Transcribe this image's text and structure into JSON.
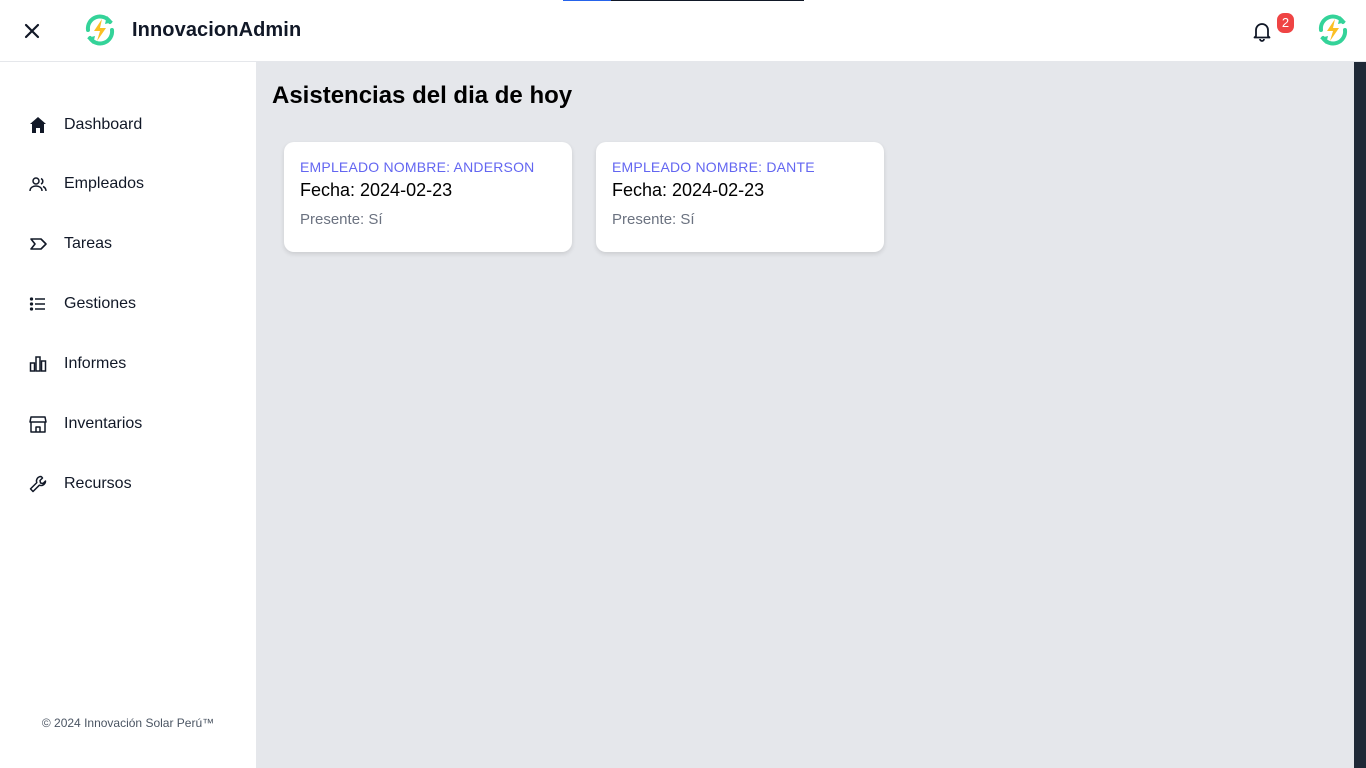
{
  "header": {
    "close_icon": "close-icon",
    "brand": "InnovacionAdmin",
    "notifications_count": "2",
    "colors": {
      "logo_green": "#34d399",
      "logo_bolt": "#fbbf24",
      "badge": "#ef4444"
    }
  },
  "sidebar": {
    "items": [
      {
        "label": "Dashboard",
        "icon": "home-icon"
      },
      {
        "label": "Empleados",
        "icon": "users-icon"
      },
      {
        "label": "Tareas",
        "icon": "tag-icon"
      },
      {
        "label": "Gestiones",
        "icon": "list-icon"
      },
      {
        "label": "Informes",
        "icon": "bar-chart-icon"
      },
      {
        "label": "Inventarios",
        "icon": "store-icon"
      },
      {
        "label": "Recursos",
        "icon": "wrench-icon"
      }
    ],
    "footer": "© 2024 Innovación Solar Perú™"
  },
  "main": {
    "title": "Asistencias del dia de hoy",
    "cards": [
      {
        "name": "Empleado Nombre: Anderson",
        "date": "Fecha: 2024-02-23",
        "present": "Presente: Sí"
      },
      {
        "name": "Empleado Nombre: Dante",
        "date": "Fecha: 2024-02-23",
        "present": "Presente: Sí"
      }
    ],
    "colors": {
      "accent": "#6366f1",
      "background": "#e5e7eb"
    }
  }
}
